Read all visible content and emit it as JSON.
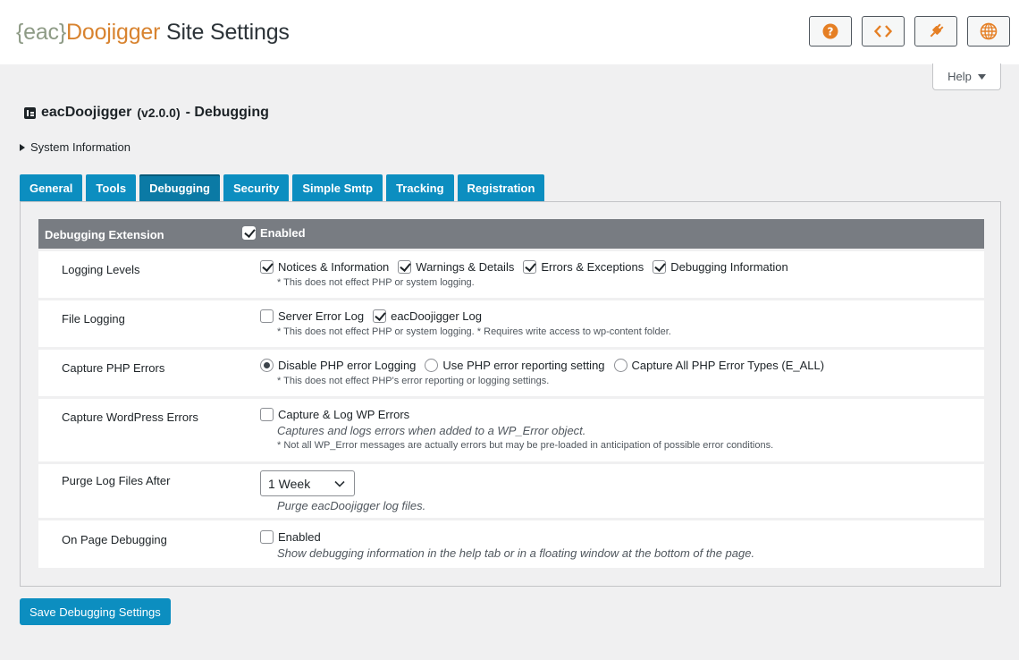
{
  "header": {
    "brand_open": "{eac}",
    "brand_name": "Doojigger",
    "brand_suffix": " Site Settings",
    "buttons": [
      {
        "icon": "help-circle-icon"
      },
      {
        "icon": "code-icon"
      },
      {
        "icon": "plugin-icon"
      },
      {
        "icon": "globe-icon"
      }
    ],
    "help_label": "Help"
  },
  "page": {
    "title": "eacDoojigger",
    "version": "(v2.0.0)",
    "subtitle": "- Debugging",
    "system_info": "System Information"
  },
  "tabs": [
    {
      "label": "General",
      "active": false
    },
    {
      "label": "Tools",
      "active": false
    },
    {
      "label": "Debugging",
      "active": true
    },
    {
      "label": "Security",
      "active": false
    },
    {
      "label": "Simple Smtp",
      "active": false
    },
    {
      "label": "Tracking",
      "active": false
    },
    {
      "label": "Registration",
      "active": false
    }
  ],
  "section": {
    "label": "Debugging Extension",
    "enabled_label": "Enabled",
    "enabled": true
  },
  "rows": {
    "logging_levels": {
      "label": "Logging Levels",
      "options": [
        {
          "label": "Notices & Information",
          "checked": true
        },
        {
          "label": "Warnings & Details",
          "checked": true
        },
        {
          "label": "Errors & Exceptions",
          "checked": true
        },
        {
          "label": "Debugging Information",
          "checked": true
        }
      ],
      "note": "* This does not effect PHP or system logging."
    },
    "file_logging": {
      "label": "File Logging",
      "options": [
        {
          "label": "Server Error Log",
          "checked": false
        },
        {
          "label": "eacDoojigger Log",
          "checked": true
        }
      ],
      "note": "* This does not effect PHP or system logging. * Requires write access to wp-content folder."
    },
    "capture_php": {
      "label": "Capture PHP Errors",
      "options": [
        {
          "label": "Disable PHP error Logging",
          "checked": true
        },
        {
          "label": "Use PHP error reporting setting",
          "checked": false
        },
        {
          "label": "Capture All PHP Error Types (E_ALL)",
          "checked": false
        }
      ],
      "note": "* This does not effect PHP's error reporting or logging settings."
    },
    "capture_wp": {
      "label": "Capture WordPress Errors",
      "option": {
        "label": "Capture & Log WP Errors",
        "checked": false
      },
      "desc": "Captures and logs errors when added to a WP_Error object.",
      "note": "* Not all WP_Error messages are actually errors but may be pre-loaded in anticipation of possible error conditions."
    },
    "purge": {
      "label": "Purge Log Files After",
      "selected": "1 Week",
      "desc": "Purge eacDoojigger log files."
    },
    "on_page": {
      "label": "On Page Debugging",
      "option": {
        "label": "Enabled",
        "checked": false
      },
      "desc": "Show debugging information in the help tab or in a floating window at the bottom of the page."
    }
  },
  "save_label": "Save Debugging Settings",
  "colors": {
    "accent": "#0c8ec0",
    "brand_brace": "#8e9b86",
    "brand_name": "#d8832f",
    "section_header": "#787c82"
  }
}
